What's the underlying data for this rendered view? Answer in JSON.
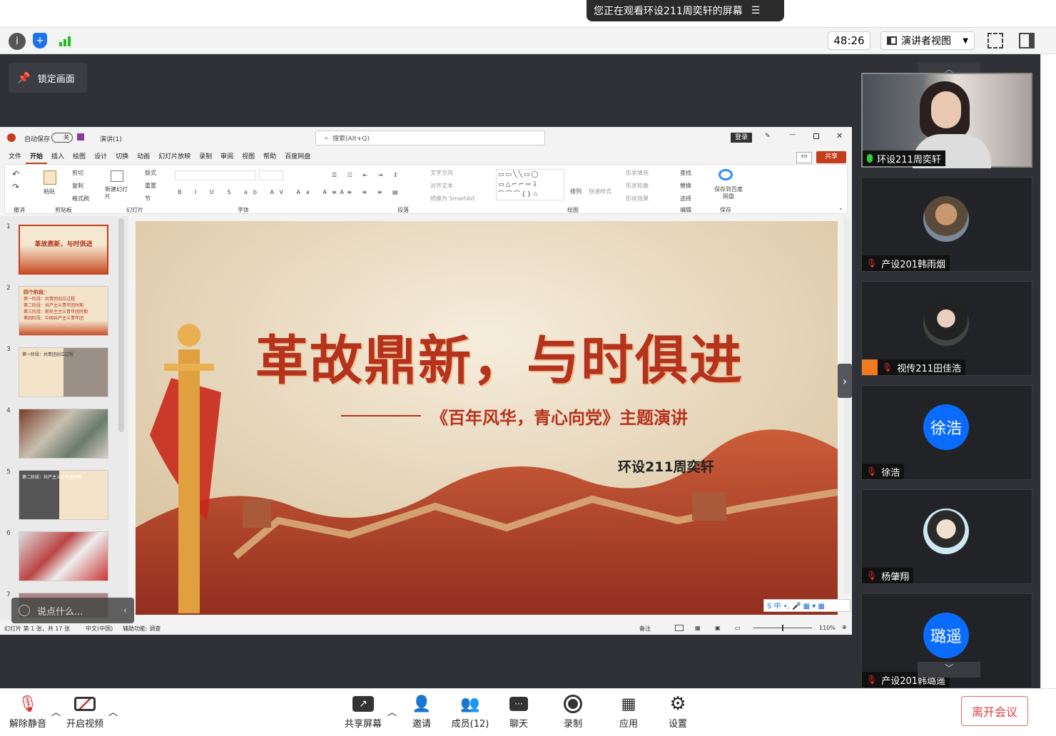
{
  "banner": {
    "text": "您正在观看环设211周奕轩的屏幕"
  },
  "toolbar": {
    "timer": "48:26",
    "view_mode": "演讲者视图"
  },
  "lock": {
    "label": "锁定画面"
  },
  "ppt": {
    "autosave": "自动保存",
    "autosave_state": "关",
    "doc_name": "演讲(1)",
    "search_placeholder": "搜索(Alt+Q)",
    "login": "登录",
    "share": "共享",
    "menu": [
      "文件",
      "开始",
      "插入",
      "绘图",
      "设计",
      "切换",
      "动画",
      "幻灯片放映",
      "录制",
      "审阅",
      "视图",
      "帮助",
      "百度网盘"
    ],
    "groups": {
      "undo": "撤消",
      "clipboard": "剪贴板",
      "slides": "幻灯片",
      "font": "字体",
      "paragraph": "段落",
      "drawing": "绘图",
      "editing": "编辑",
      "save": "保存"
    },
    "ribbon": {
      "paste": "粘贴",
      "cut": "剪切",
      "copy": "复制",
      "format_painter": "格式刷",
      "new_slide": "新建幻灯片",
      "layout": "版式",
      "reset": "重置",
      "section": "节",
      "text_direction": "文字方向",
      "align_text": "对齐文本",
      "smartart": "转换为 SmartArt",
      "arrange": "排列",
      "quick_styles": "快速样式",
      "shape_fill": "形状填充",
      "shape_outline": "形状轮廓",
      "shape_effects": "形状效果",
      "find": "查找",
      "replace": "替换",
      "select": "选择",
      "save_baidu": "保存到百度网盘"
    },
    "thumbs": [
      {
        "n": "1",
        "title": "革故鼎新，与时俱进"
      },
      {
        "n": "2",
        "title": "四个阶段：",
        "lines": [
          "第一阶段：共青团创立过程",
          "第二阶段：共产主义青年团时期",
          "第三阶段：新民主主义青年团时期",
          "第四阶段：中国共产主义青年团"
        ]
      },
      {
        "n": "3",
        "title": "第一阶段：共青团创立过程"
      },
      {
        "n": "4"
      },
      {
        "n": "5",
        "title": "第二阶段：共产主义青年团时期"
      },
      {
        "n": "6"
      },
      {
        "n": "7"
      }
    ],
    "slide": {
      "title": "革故鼎新，与时俱进",
      "subtitle": "《百年风华，青心向党》主题演讲",
      "author": "环设211周奕轩"
    },
    "status": {
      "slide_of": "幻灯片 第 1 张，共 17 张",
      "lang": "中文(中国)",
      "access": "辅助功能: 调查",
      "notes": "备注",
      "zoom": "110%"
    }
  },
  "say": {
    "placeholder": "说点什么..."
  },
  "participants": [
    {
      "name": "环设211周奕轩",
      "kind": "video"
    },
    {
      "name": "产设201韩雨烟",
      "kind": "photo"
    },
    {
      "name": "视传211田佳浩",
      "kind": "photo"
    },
    {
      "name": "徐浩",
      "kind": "initials",
      "initials": "徐浩"
    },
    {
      "name": "杨肇翔",
      "kind": "photo"
    },
    {
      "name": "产设201韩璐遥",
      "kind": "initials",
      "initials": "璐遥"
    }
  ],
  "bottom": {
    "mute": "解除静音",
    "video": "开启视频",
    "share": "共享屏幕",
    "invite": "邀请",
    "members": "成员(12)",
    "chat": "聊天",
    "record": "录制",
    "apps": "应用",
    "settings": "设置",
    "leave": "离开会议"
  },
  "colors": {
    "accent": "#0a6cff",
    "leave": "#e23c3c",
    "slide_red": "#b5321c"
  }
}
